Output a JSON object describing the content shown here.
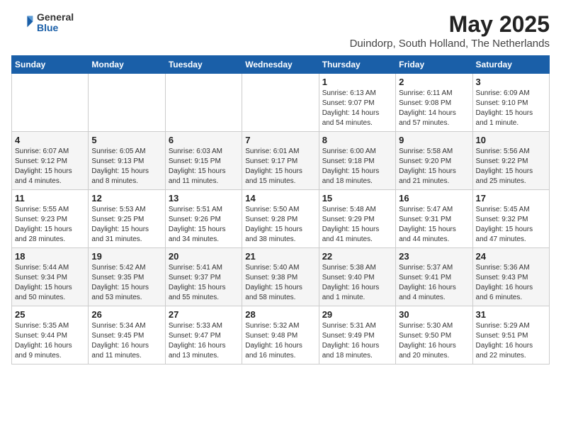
{
  "header": {
    "logo_general": "General",
    "logo_blue": "Blue",
    "month_title": "May 2025",
    "location": "Duindorp, South Holland, The Netherlands"
  },
  "days_of_week": [
    "Sunday",
    "Monday",
    "Tuesday",
    "Wednesday",
    "Thursday",
    "Friday",
    "Saturday"
  ],
  "weeks": [
    [
      {
        "day": "",
        "info": ""
      },
      {
        "day": "",
        "info": ""
      },
      {
        "day": "",
        "info": ""
      },
      {
        "day": "",
        "info": ""
      },
      {
        "day": "1",
        "info": "Sunrise: 6:13 AM\nSunset: 9:07 PM\nDaylight: 14 hours\nand 54 minutes."
      },
      {
        "day": "2",
        "info": "Sunrise: 6:11 AM\nSunset: 9:08 PM\nDaylight: 14 hours\nand 57 minutes."
      },
      {
        "day": "3",
        "info": "Sunrise: 6:09 AM\nSunset: 9:10 PM\nDaylight: 15 hours\nand 1 minute."
      }
    ],
    [
      {
        "day": "4",
        "info": "Sunrise: 6:07 AM\nSunset: 9:12 PM\nDaylight: 15 hours\nand 4 minutes."
      },
      {
        "day": "5",
        "info": "Sunrise: 6:05 AM\nSunset: 9:13 PM\nDaylight: 15 hours\nand 8 minutes."
      },
      {
        "day": "6",
        "info": "Sunrise: 6:03 AM\nSunset: 9:15 PM\nDaylight: 15 hours\nand 11 minutes."
      },
      {
        "day": "7",
        "info": "Sunrise: 6:01 AM\nSunset: 9:17 PM\nDaylight: 15 hours\nand 15 minutes."
      },
      {
        "day": "8",
        "info": "Sunrise: 6:00 AM\nSunset: 9:18 PM\nDaylight: 15 hours\nand 18 minutes."
      },
      {
        "day": "9",
        "info": "Sunrise: 5:58 AM\nSunset: 9:20 PM\nDaylight: 15 hours\nand 21 minutes."
      },
      {
        "day": "10",
        "info": "Sunrise: 5:56 AM\nSunset: 9:22 PM\nDaylight: 15 hours\nand 25 minutes."
      }
    ],
    [
      {
        "day": "11",
        "info": "Sunrise: 5:55 AM\nSunset: 9:23 PM\nDaylight: 15 hours\nand 28 minutes."
      },
      {
        "day": "12",
        "info": "Sunrise: 5:53 AM\nSunset: 9:25 PM\nDaylight: 15 hours\nand 31 minutes."
      },
      {
        "day": "13",
        "info": "Sunrise: 5:51 AM\nSunset: 9:26 PM\nDaylight: 15 hours\nand 34 minutes."
      },
      {
        "day": "14",
        "info": "Sunrise: 5:50 AM\nSunset: 9:28 PM\nDaylight: 15 hours\nand 38 minutes."
      },
      {
        "day": "15",
        "info": "Sunrise: 5:48 AM\nSunset: 9:29 PM\nDaylight: 15 hours\nand 41 minutes."
      },
      {
        "day": "16",
        "info": "Sunrise: 5:47 AM\nSunset: 9:31 PM\nDaylight: 15 hours\nand 44 minutes."
      },
      {
        "day": "17",
        "info": "Sunrise: 5:45 AM\nSunset: 9:32 PM\nDaylight: 15 hours\nand 47 minutes."
      }
    ],
    [
      {
        "day": "18",
        "info": "Sunrise: 5:44 AM\nSunset: 9:34 PM\nDaylight: 15 hours\nand 50 minutes."
      },
      {
        "day": "19",
        "info": "Sunrise: 5:42 AM\nSunset: 9:35 PM\nDaylight: 15 hours\nand 53 minutes."
      },
      {
        "day": "20",
        "info": "Sunrise: 5:41 AM\nSunset: 9:37 PM\nDaylight: 15 hours\nand 55 minutes."
      },
      {
        "day": "21",
        "info": "Sunrise: 5:40 AM\nSunset: 9:38 PM\nDaylight: 15 hours\nand 58 minutes."
      },
      {
        "day": "22",
        "info": "Sunrise: 5:38 AM\nSunset: 9:40 PM\nDaylight: 16 hours\nand 1 minute."
      },
      {
        "day": "23",
        "info": "Sunrise: 5:37 AM\nSunset: 9:41 PM\nDaylight: 16 hours\nand 4 minutes."
      },
      {
        "day": "24",
        "info": "Sunrise: 5:36 AM\nSunset: 9:43 PM\nDaylight: 16 hours\nand 6 minutes."
      }
    ],
    [
      {
        "day": "25",
        "info": "Sunrise: 5:35 AM\nSunset: 9:44 PM\nDaylight: 16 hours\nand 9 minutes."
      },
      {
        "day": "26",
        "info": "Sunrise: 5:34 AM\nSunset: 9:45 PM\nDaylight: 16 hours\nand 11 minutes."
      },
      {
        "day": "27",
        "info": "Sunrise: 5:33 AM\nSunset: 9:47 PM\nDaylight: 16 hours\nand 13 minutes."
      },
      {
        "day": "28",
        "info": "Sunrise: 5:32 AM\nSunset: 9:48 PM\nDaylight: 16 hours\nand 16 minutes."
      },
      {
        "day": "29",
        "info": "Sunrise: 5:31 AM\nSunset: 9:49 PM\nDaylight: 16 hours\nand 18 minutes."
      },
      {
        "day": "30",
        "info": "Sunrise: 5:30 AM\nSunset: 9:50 PM\nDaylight: 16 hours\nand 20 minutes."
      },
      {
        "day": "31",
        "info": "Sunrise: 5:29 AM\nSunset: 9:51 PM\nDaylight: 16 hours\nand 22 minutes."
      }
    ]
  ]
}
